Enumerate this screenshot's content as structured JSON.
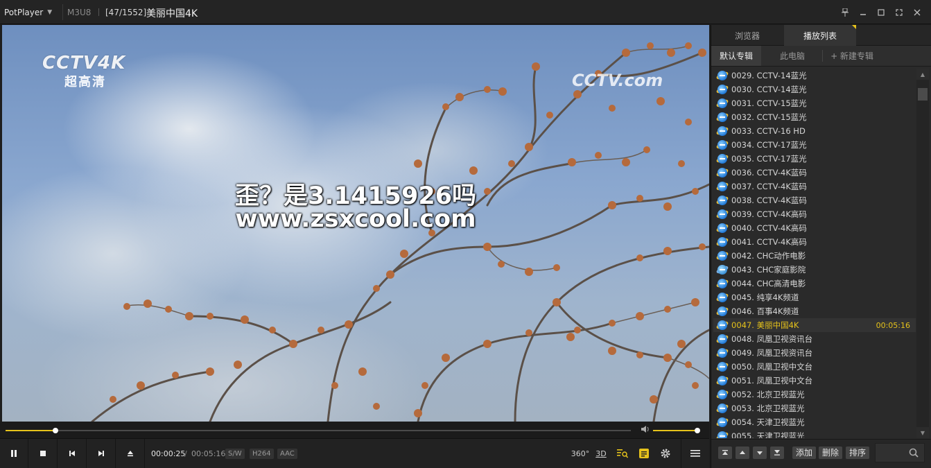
{
  "titlebar": {
    "app_name": "PotPlayer",
    "format": "M3U8",
    "index": "[47/1552]",
    "title": "美丽中国4K"
  },
  "video": {
    "logo_main": "CCTV4K",
    "logo_sub": "超高清",
    "watermark": "CCTV.com",
    "overlay_line1": "歪？是3.1415926吗",
    "overlay_line2": "www.zsxcool.com"
  },
  "seek": {
    "progress": 0.0797,
    "volume": 0.97
  },
  "controls": {
    "time_current": "00:00:25",
    "time_separator": "/",
    "time_total": "00:05:16",
    "badges": [
      "S/W",
      "H264",
      "AAC"
    ],
    "btn_360": "360°",
    "btn_3d": "3D"
  },
  "panel": {
    "tabs": [
      "浏览器",
      "播放列表"
    ],
    "subtabs": [
      "默认专辑",
      "此电脑",
      "+ 新建专辑"
    ],
    "items": [
      {
        "label": "0029. CCTV-14蓝光",
        "icon": "ie-icon"
      },
      {
        "label": "0030. CCTV-14蓝光",
        "icon": "ie-icon"
      },
      {
        "label": "0031. CCTV-15蓝光",
        "icon": "ie-icon"
      },
      {
        "label": "0032. CCTV-15蓝光",
        "icon": "ie-icon"
      },
      {
        "label": "0033. CCTV-16 HD",
        "icon": "ie-icon"
      },
      {
        "label": "0034. CCTV-17蓝光",
        "icon": "ie-icon"
      },
      {
        "label": "0035. CCTV-17蓝光",
        "icon": "ie-icon"
      },
      {
        "label": "0036. CCTV-4K蓝码",
        "icon": "ie-icon"
      },
      {
        "label": "0037. CCTV-4K蓝码",
        "icon": "ie-icon"
      },
      {
        "label": "0038. CCTV-4K蓝码",
        "icon": "ie-icon"
      },
      {
        "label": "0039. CCTV-4K高码",
        "icon": "ie-icon"
      },
      {
        "label": "0040. CCTV-4K高码",
        "icon": "ie-icon"
      },
      {
        "label": "0041. CCTV-4K高码",
        "icon": "ie-icon"
      },
      {
        "label": "0042. CHC动作电影",
        "icon": "ie-icon"
      },
      {
        "label": "0043. CHC家庭影院",
        "icon": "network-icon"
      },
      {
        "label": "0044. CHC高清电影",
        "icon": "ie-icon"
      },
      {
        "label": "0045. 纯享4K频道",
        "icon": "ie-icon"
      },
      {
        "label": "0046. 百事4K频道",
        "icon": "ie-icon"
      },
      {
        "label": "0047. 美丽中国4K",
        "icon": "ie-icon",
        "duration": "00:05:16",
        "current": true
      },
      {
        "label": "0048. 凤凰卫视资讯台",
        "icon": "ie-icon"
      },
      {
        "label": "0049. 凤凰卫视资讯台",
        "icon": "ie-icon"
      },
      {
        "label": "0050. 凤凰卫视中文台",
        "icon": "ie-icon"
      },
      {
        "label": "0051. 凤凰卫视中文台",
        "icon": "ie-icon"
      },
      {
        "label": "0052. 北京卫视蓝光",
        "icon": "ie-icon"
      },
      {
        "label": "0053. 北京卫视蓝光",
        "icon": "ie-icon"
      },
      {
        "label": "0054. 天津卫视蓝光",
        "icon": "ie-icon"
      },
      {
        "label": "0055. 天津卫视蓝光",
        "icon": "ie-icon"
      }
    ],
    "bottom_buttons": [
      "添加",
      "删除",
      "排序"
    ]
  },
  "colors": {
    "accent": "#e5c21b",
    "background": "#1e1e1e",
    "panel": "#2a2a2a"
  }
}
